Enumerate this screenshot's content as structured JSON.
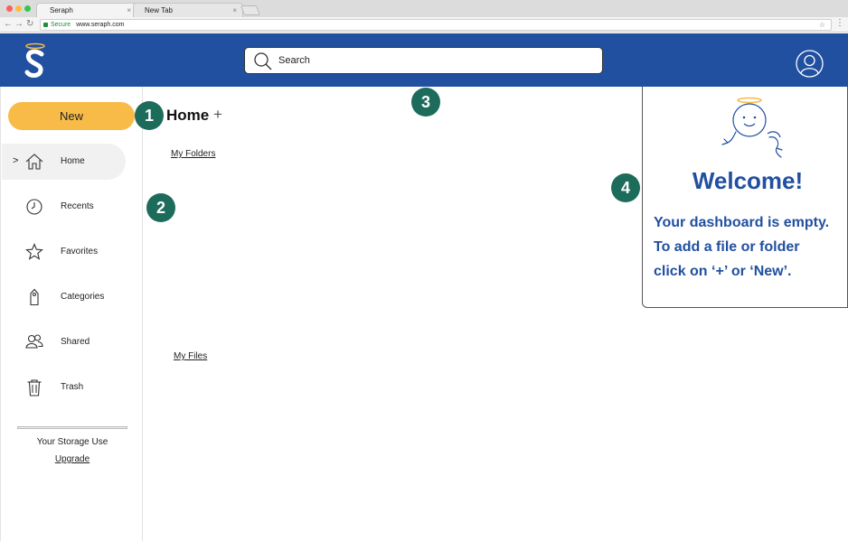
{
  "browser": {
    "active_tab": "Seraph",
    "inactive_tab": "New Tab",
    "tab_close_glyph": "×",
    "secure_label": "Secure",
    "url": "www.seraph.com"
  },
  "header": {
    "search_placeholder": "Search",
    "logo_icon": "seraph-logo-icon",
    "avatar_icon": "user-avatar-icon",
    "brand_color": "#2150a0"
  },
  "sidebar": {
    "new_label": "New",
    "new_color": "#f8bb47",
    "items": [
      {
        "label": "Home",
        "icon": "home-icon",
        "active": true
      },
      {
        "label": "Recents",
        "icon": "clock-icon",
        "active": false
      },
      {
        "label": "Favorites",
        "icon": "star-icon",
        "active": false
      },
      {
        "label": "Categories",
        "icon": "tag-icon",
        "active": false
      },
      {
        "label": "Shared",
        "icon": "people-icon",
        "active": false
      },
      {
        "label": "Trash",
        "icon": "trash-icon",
        "active": false
      }
    ],
    "chevron": ">",
    "storage_label": "Your Storage Use",
    "upgrade_label": "Upgrade"
  },
  "main": {
    "title": "Home",
    "add_glyph": "+",
    "folders_label": "My Folders",
    "files_label": "My Files"
  },
  "markers": [
    "1",
    "2",
    "3",
    "4"
  ],
  "marker_color": "#1d6b5b",
  "welcome": {
    "title": "Welcome!",
    "lines": [
      "Your dashboard is empty.",
      "To add a file or folder",
      "click on ‘+’ or ‘New’."
    ]
  }
}
